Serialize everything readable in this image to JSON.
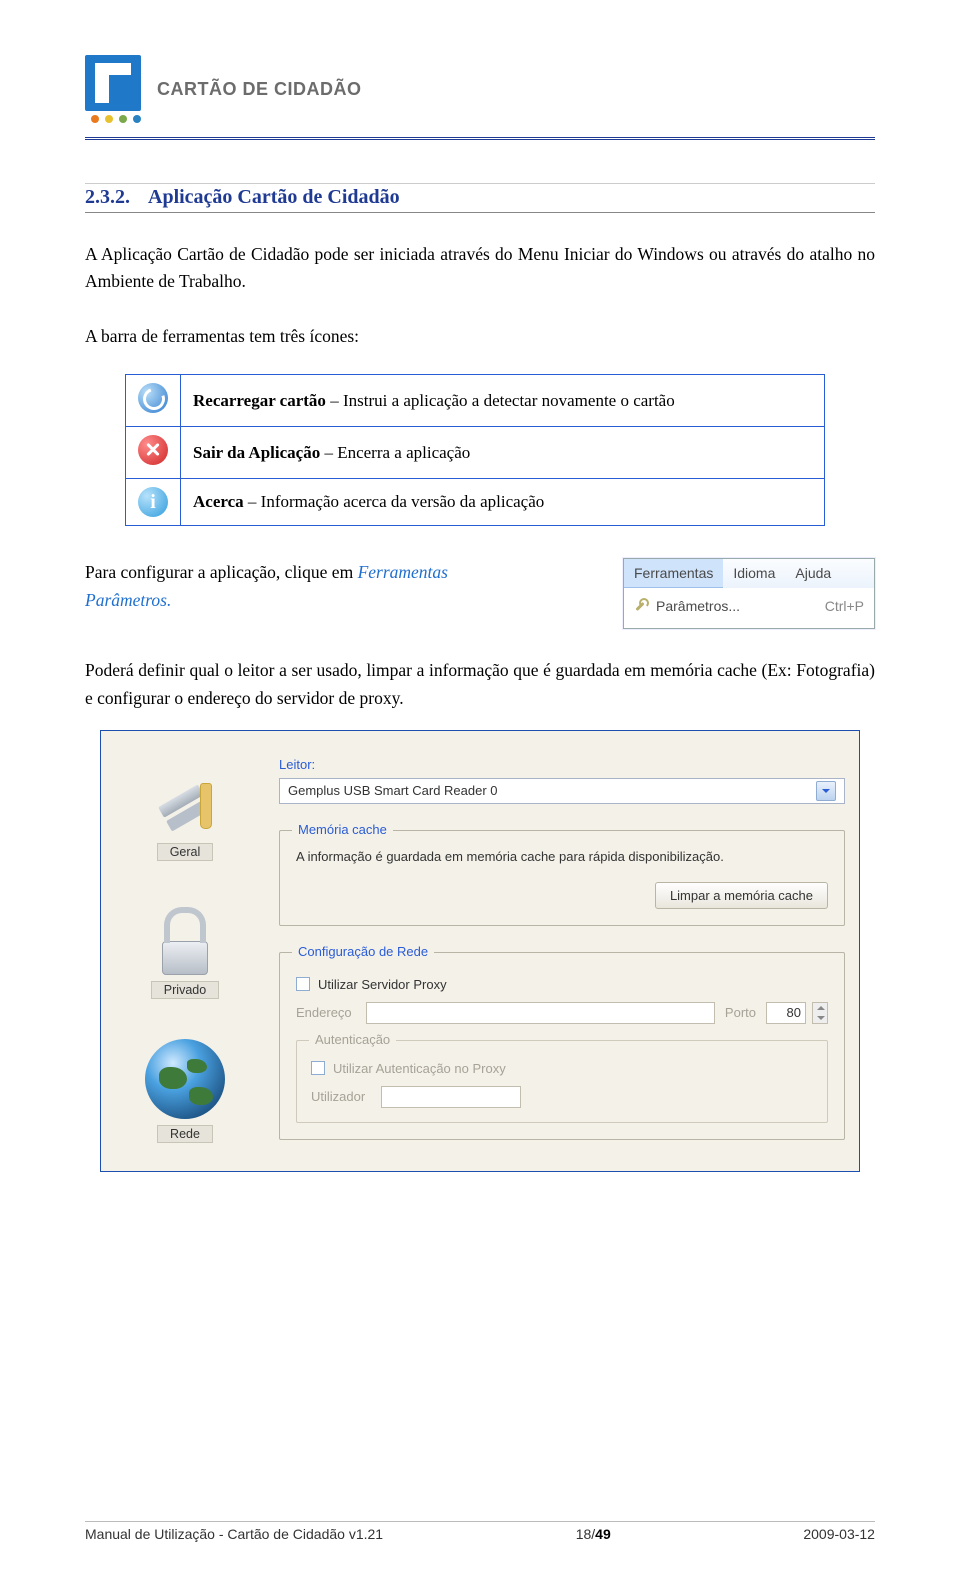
{
  "header": {
    "brand": "CARTÃO DE CIDADÃO"
  },
  "section": {
    "number": "2.3.2.",
    "title": "Aplicação Cartão de Cidadão"
  },
  "para1": "A Aplicação Cartão de Cidadão pode ser iniciada através do Menu Iniciar do Windows ou através do atalho no Ambiente de Trabalho.",
  "para2": "A barra de ferramentas tem três ícones:",
  "icon_rows": [
    {
      "bold": "Recarregar cartão",
      "rest": " – Instrui a aplicação a detectar novamente o cartão"
    },
    {
      "bold": "Sair da Aplicação",
      "rest": " – Encerra a aplicação"
    },
    {
      "bold": "Acerca",
      "rest": " – Informação acerca da versão da aplicação"
    }
  ],
  "mid": {
    "lead": "Para configurar a aplicação, clique em ",
    "fer": "Ferramentas",
    "par": "Parâmetros."
  },
  "menu": {
    "ferramentas": "Ferramentas",
    "idioma": "Idioma",
    "ajuda": "Ajuda",
    "parametros": "Parâmetros...",
    "shortcut": "Ctrl+P"
  },
  "para3": "Poderá definir qual o leitor a ser usado, limpar a informação que é guardada em memória cache (Ex: Fotografia) e configurar o endereço do servidor de proxy.",
  "settings": {
    "tabs": {
      "geral": "Geral",
      "privado": "Privado",
      "rede": "Rede"
    },
    "leitor_label": "Leitor:",
    "leitor_value": "Gemplus USB Smart Card Reader 0",
    "cache_legend": "Memória cache",
    "cache_text": "A informação é guardada em memória cache para rápida disponibilização.",
    "cache_btn": "Limpar a memória cache",
    "net_legend": "Configuração de Rede",
    "use_proxy": "Utilizar Servidor Proxy",
    "addr_label": "Endereço",
    "port_label": "Porto",
    "port_value": "80",
    "auth_legend": "Autenticação",
    "use_auth": "Utilizar Autenticação no Proxy",
    "user_label": "Utilizador"
  },
  "footer": {
    "left": "Manual de Utilização - Cartão de Cidadão v1.21",
    "page_cur": "18",
    "page_sep": "/",
    "page_total": "49",
    "right": "2009-03-12"
  }
}
